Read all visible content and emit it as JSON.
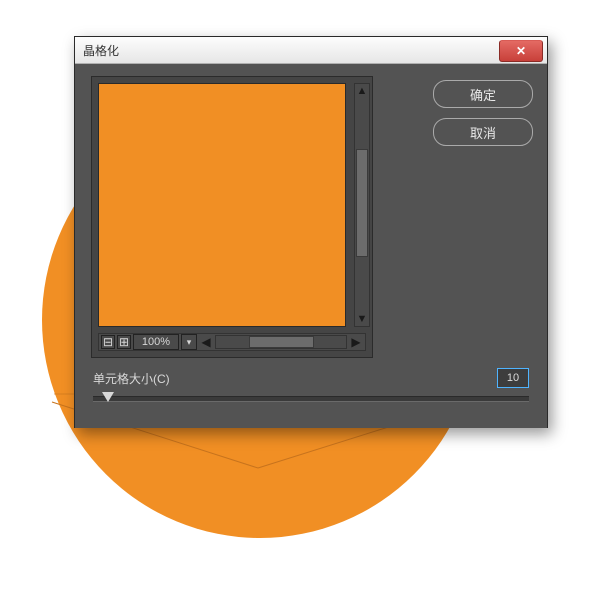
{
  "dialog": {
    "title": "晶格化",
    "actions": {
      "ok_label": "确定",
      "cancel_label": "取消"
    },
    "preview": {
      "zoom_value": "100%"
    },
    "param": {
      "label": "单元格大小(C)",
      "value": "10"
    }
  },
  "colors": {
    "orange": "#f18f24",
    "dialog_bg": "#535353"
  }
}
